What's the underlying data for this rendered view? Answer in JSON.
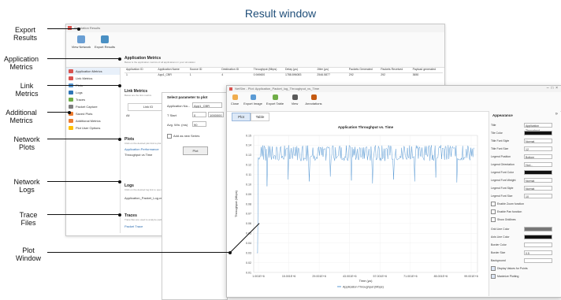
{
  "title": "Result window",
  "callouts": {
    "export_results": "Export\nResults",
    "application_metrics": "Application\nMetrics",
    "link_metrics": "Link\nMetrics",
    "additional_metrics": "Additional\nMetrics",
    "network_plots": "Network\nPlots",
    "network_logs": "Network\nLogs",
    "trace_files": "Trace\nFiles",
    "plot_window": "Plot\nWindow"
  },
  "results_window": {
    "title": "Simulation Results",
    "toolbar": [
      "View Network",
      "Export Results"
    ],
    "sidebar": [
      "Application Metrics",
      "Link Metrics",
      "Plots",
      "Logs",
      "Traces",
      "Packet Capture",
      "Saved Plots",
      "Additional Metrics",
      "Plot User Options"
    ],
    "app_metrics": {
      "heading": "Application Metrics",
      "sub": "Below is the application metrics of all applications in your simulation",
      "columns": [
        "Application ID",
        "Application Name",
        "Source ID",
        "Destination ID",
        "Throughput (Mbps)",
        "Delay (µs)",
        "Jitter (µs)",
        "Packets Generated",
        "Packets Received",
        "Payload generated"
      ],
      "row": [
        "1",
        "App1_CBR",
        "1",
        "4",
        "0.949600",
        "1788.896083",
        "2546.5877",
        "292",
        "292",
        "3650"
      ]
    },
    "link_metrics": {
      "heading": "Link Metrics",
      "sub": "Below are the link metrics",
      "link_id": "Link ID",
      "all": "All"
    },
    "plots": {
      "heading": "Plots",
      "sub": "Click on the desired plot link to plot the data",
      "item1": "Application Performance",
      "item2": "Throughput vs Time"
    },
    "logs": {
      "heading": "Logs",
      "sub": "Click on the desired log link to open the log file",
      "item1": "Application_Packet_Log.csv"
    },
    "traces": {
      "heading": "Traces",
      "sub": "Trace files are used to analyze packet level details",
      "item1": "Packet Trace"
    }
  },
  "select_dialog": {
    "heading": "Select parameter to plot",
    "app_label": "Application Na...",
    "app_value": "App1_CBR",
    "ymin_label": "T Start",
    "ymin_value": "0",
    "ymax_value": "1000000",
    "avg_label": "Avg. Win. (ms)",
    "avg_value": "90",
    "add_series": "Add as new Series",
    "plot_button": "Plot"
  },
  "plot_window": {
    "title": "NetSim - Plot: Application_Packet_log_Throughput_vs_Time",
    "toolbar": [
      "Close",
      "Export Image",
      "Export Table",
      "View",
      "Annotations"
    ],
    "tabs": [
      "Plot",
      "Table"
    ],
    "properties_header": "Appearance",
    "properties": [
      {
        "label": "Title",
        "value": "Application Throughput"
      },
      {
        "label": "Tile Color",
        "value": ""
      },
      {
        "label": "Title Font Style",
        "value": "Normal"
      },
      {
        "label": "Title Font Size",
        "value": "12"
      },
      {
        "label": "Legend Position",
        "value": "Bottom"
      },
      {
        "label": "Legend Orientation",
        "value": "Hori..."
      },
      {
        "label": "Legend Font Color",
        "value": ""
      },
      {
        "label": "Legend Font Weight",
        "value": "Normal"
      },
      {
        "label": "Legend Font Style",
        "value": "Normal"
      },
      {
        "label": "Legend Font Size",
        "value": "10"
      }
    ],
    "checkboxes": [
      "Enable Zoom function",
      "Enable Pan function",
      "Show Gridlines"
    ],
    "lower_props": [
      {
        "label": "Grid Line Color",
        "value": ""
      },
      {
        "label": "Axis Line Color",
        "value": ""
      },
      {
        "label": "Border Color",
        "value": ""
      },
      {
        "label": "Border Size",
        "value": "0.5"
      },
      {
        "label": "Background",
        "value": ""
      }
    ],
    "checkboxes2": [
      "Display Values for Points",
      "Maximize Plotting"
    ]
  },
  "chart_data": {
    "type": "line",
    "title": "Application Throughput vs. Time",
    "xlabel": "Time (µs)",
    "ylabel": "Throughput (Mbps)",
    "ylim": [
      0.01,
      0.15
    ],
    "yticks": [
      "0.15",
      "0.14",
      "0.13",
      "0.12",
      "0.11",
      "0.10",
      "0.09",
      "0.08",
      "0.07",
      "0.06",
      "0.05",
      "0.04",
      "0.03",
      "0.02",
      "0.01"
    ],
    "xticks": [
      "1.001E+6",
      "15.001E+6",
      "29.001E+6",
      "43.001E+6",
      "57.001E+6",
      "71.001E+6",
      "85.001E+6",
      "99.001E+6"
    ],
    "series": [
      {
        "name": "Application Throughput (Mbps)",
        "base": 0.124,
        "high": 0.14,
        "dips": [
          0.098,
          0.105,
          0.103,
          0.108,
          0.104,
          0.101,
          0.105,
          0.103,
          0.107,
          0.102
        ],
        "start_low": 0.03
      }
    ],
    "legend": "bottom",
    "grid": true,
    "color": "#5b9bd5"
  }
}
